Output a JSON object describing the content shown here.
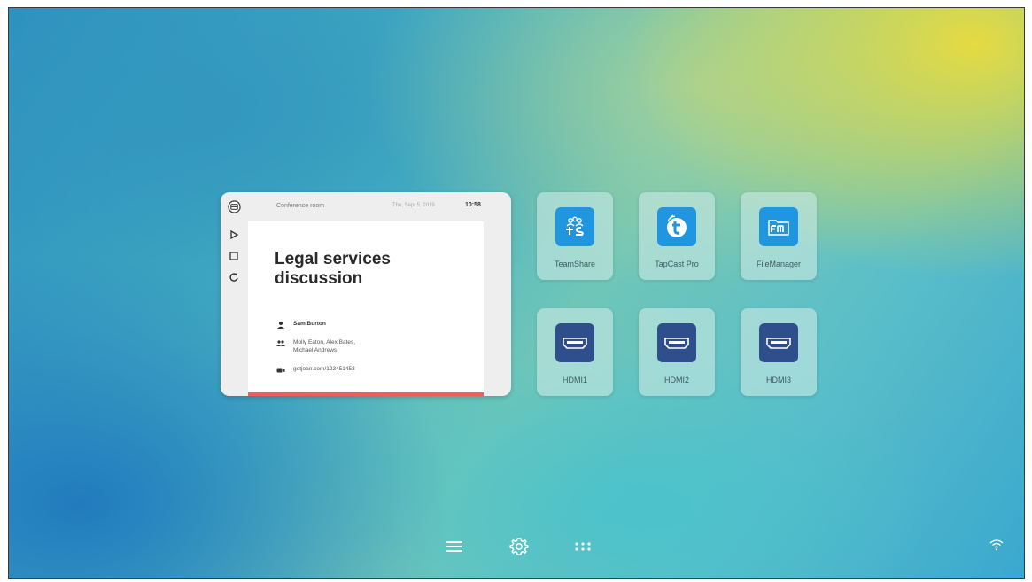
{
  "meeting_card": {
    "room": "Conference room",
    "date": "Thu, Sept 5, 2019",
    "time": "10:58",
    "title": "Legal services discussion",
    "organizer": "Sam Burton",
    "attendees_line1": "Molly Eaton, Alex Bates,",
    "attendees_line2": "Michael Andrews",
    "link": "getjoan.com/123451453",
    "sidebar_icons": [
      "joan-logo-icon",
      "play-icon",
      "stop-icon",
      "refresh-icon"
    ],
    "accent_color": "#ef5d5d"
  },
  "apps": [
    {
      "label": "TeamShare",
      "icon": "teamshare-icon",
      "color": "#2196e0"
    },
    {
      "label": "TapCast Pro",
      "icon": "tapcast-icon",
      "color": "#2196e0"
    },
    {
      "label": "FileManager",
      "icon": "filemanager-icon",
      "color": "#2196e0"
    }
  ],
  "inputs": [
    {
      "label": "HDMI1",
      "icon": "hdmi-icon",
      "color": "#2f4f8c"
    },
    {
      "label": "HDMI2",
      "icon": "hdmi-icon",
      "color": "#2f4f8c"
    },
    {
      "label": "HDMI3",
      "icon": "hdmi-icon",
      "color": "#2f4f8c"
    }
  ],
  "bottom_bar": {
    "icons": [
      "menu-icon",
      "settings-icon",
      "apps-grid-icon"
    ],
    "status_icon": "wifi-icon"
  }
}
